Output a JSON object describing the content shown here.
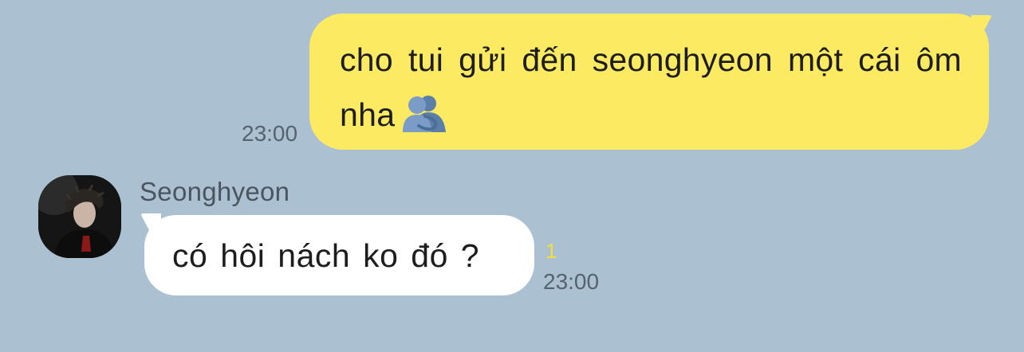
{
  "chat": {
    "messages_out": [
      {
        "text": "cho tui gửi đến seonghyeon một cái ôm nha",
        "emoji": "people-hugging-icon",
        "time": "23:00"
      }
    ],
    "messages_in": [
      {
        "sender": "Seonghyeon",
        "text": "có hôi nách ko đó ?",
        "unread": "1",
        "time": "23:00"
      }
    ]
  },
  "colors": {
    "background": "#abc1d1",
    "outgoing_bubble": "#fdea63",
    "incoming_bubble": "#ffffff",
    "unread_count": "#f3de3c",
    "timestamp": "#556270"
  }
}
